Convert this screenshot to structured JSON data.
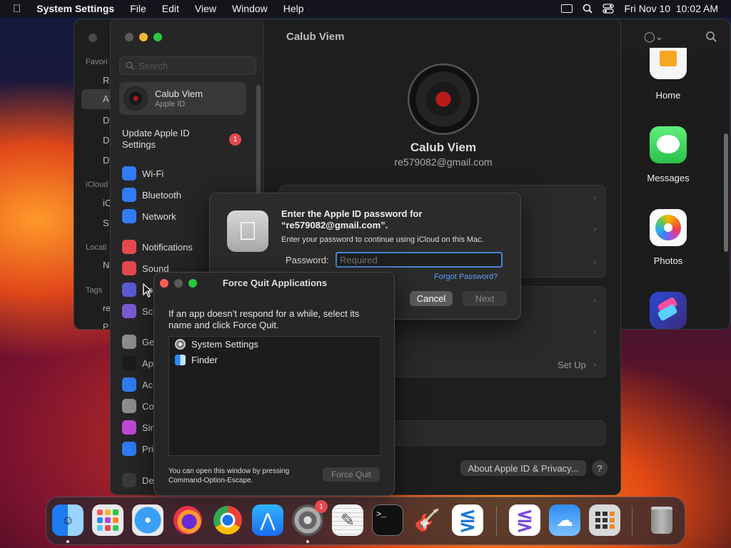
{
  "menubar": {
    "app": "System Settings",
    "items": [
      "File",
      "Edit",
      "View",
      "Window",
      "Help"
    ],
    "clock": "Fri Nov 10  10:02 AM"
  },
  "back_window": {
    "sidebar_items": [
      "Favori",
      "R",
      "A",
      "D",
      "D",
      "D",
      "iCloud",
      "iC",
      "S",
      "Locati",
      "N",
      "Tags",
      "re",
      "P"
    ]
  },
  "settings": {
    "search_placeholder": "Search",
    "account": {
      "name": "Calub Viem",
      "sub": "Apple ID"
    },
    "update": {
      "label": "Update Apple ID Settings",
      "badge": "1"
    },
    "items": [
      {
        "label": "Wi-Fi",
        "color": "#2f7cf6",
        "icon": "wifi-icon"
      },
      {
        "label": "Bluetooth",
        "color": "#2f7cf6",
        "icon": "bluetooth-icon"
      },
      {
        "label": "Network",
        "color": "#2f7cf6",
        "icon": "globe-icon"
      },
      {
        "label": "Notifications",
        "color": "#e5484d",
        "icon": "bell-icon"
      },
      {
        "label": "Sound",
        "color": "#e5484d",
        "icon": "speaker-icon"
      },
      {
        "label": "Fo",
        "color": "#5b5bd6",
        "icon": "moon-icon"
      },
      {
        "label": "Sc",
        "color": "#7b5bd6",
        "icon": "hourglass-icon"
      },
      {
        "label": "Ge",
        "color": "#8e8e93",
        "icon": "gear-icon"
      },
      {
        "label": "Ap",
        "color": "#1c1c1e",
        "icon": "appearance-icon"
      },
      {
        "label": "Ac",
        "color": "#2f7cf6",
        "icon": "accessibility-icon"
      },
      {
        "label": "Co",
        "color": "#8e8e93",
        "icon": "control-centre-icon"
      },
      {
        "label": "Sir",
        "color": "#c04ad8",
        "icon": "siri-icon"
      },
      {
        "label": "Pri",
        "color": "#2f7cf6",
        "icon": "hand-icon"
      },
      {
        "label": "De",
        "color": "#3a3a3c",
        "icon": "desktop-icon"
      }
    ],
    "title": "Calub Viem",
    "profile": {
      "name": "Calub Viem",
      "email": "re579082@gmail.com"
    },
    "setup": "Set Up",
    "about": "About Apple ID & Privacy...",
    "help": "?"
  },
  "password_dialog": {
    "title": "Enter the Apple ID password for “re579082@gmail.com”.",
    "message": "Enter your password to continue using iCloud on this Mac.",
    "field_label": "Password:",
    "placeholder": "Required",
    "forgot": "Forgot Password?",
    "cancel": "Cancel",
    "next": "Next"
  },
  "force_quit": {
    "title": "Force Quit Applications",
    "message": "If an app doesn’t respond for a while, select its name and click Force Quit.",
    "apps": [
      {
        "name": "System Settings",
        "icon": "gear-icon"
      },
      {
        "name": "Finder",
        "icon": "finder-icon"
      }
    ],
    "hint": "You can open this window by pressing Command-Option-Escape.",
    "button": "Force Quit"
  },
  "launcher": [
    {
      "label": "Home"
    },
    {
      "label": "Messages"
    },
    {
      "label": "Photos"
    }
  ],
  "dock": {
    "settings_badge": "1"
  }
}
